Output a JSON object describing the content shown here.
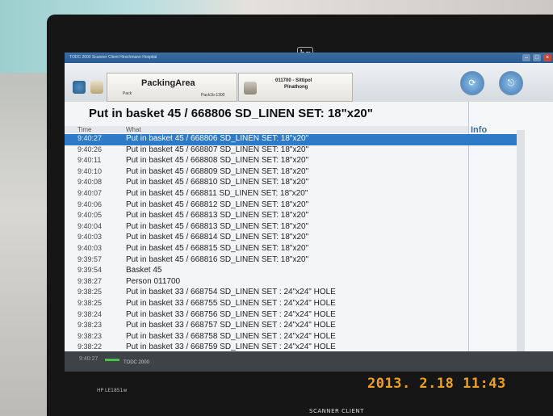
{
  "window": {
    "title": "TODC 2000 Scanner Client Hirschmann Hospital"
  },
  "toolbar": {
    "area_title": "PackingArea",
    "pack_label": "Pack",
    "station": "Pack1b-1300",
    "user_id_line": "011700 - Sittipol",
    "user_name_line": "Pinathong"
  },
  "headline": "Put in basket 45 / 668806 SD_LINEN SET: 18\"x20\"",
  "info_label": "Info",
  "columns": {
    "time": "Time",
    "what": "What"
  },
  "rows": [
    {
      "time": "9:40:27",
      "what": "Put in basket 45 / 668806 SD_LINEN SET: 18\"x20\"",
      "selected": true
    },
    {
      "time": "9:40:26",
      "what": "Put in basket 45 / 668807 SD_LINEN SET: 18\"x20\""
    },
    {
      "time": "9:40:11",
      "what": "Put in basket 45 / 668808 SD_LINEN SET: 18\"x20\""
    },
    {
      "time": "9:40:10",
      "what": "Put in basket 45 / 668809 SD_LINEN SET: 18\"x20\""
    },
    {
      "time": "9:40:08",
      "what": "Put in basket 45 / 668810 SD_LINEN SET: 18\"x20\""
    },
    {
      "time": "9:40:07",
      "what": "Put in basket 45 / 668811 SD_LINEN SET: 18\"x20\""
    },
    {
      "time": "9:40:06",
      "what": "Put in basket 45 / 668812 SD_LINEN SET: 18\"x20\""
    },
    {
      "time": "9:40:05",
      "what": "Put in basket 45 / 668813 SD_LINEN SET: 18\"x20\""
    },
    {
      "time": "9:40:04",
      "what": "Put in basket 45 / 668813 SD_LINEN SET: 18\"x20\""
    },
    {
      "time": "9:40:03",
      "what": "Put in basket 45 / 668814 SD_LINEN SET: 18\"x20\""
    },
    {
      "time": "9:40:03",
      "what": "Put in basket 45 / 668815 SD_LINEN SET: 18\"x20\""
    },
    {
      "time": "9:39:57",
      "what": "Put in basket 45 / 668816 SD_LINEN SET: 18\"x20\""
    },
    {
      "time": "9:39:54",
      "what": "Basket 45"
    },
    {
      "time": "9:38:27",
      "what": "Person 011700"
    },
    {
      "time": "9:38:25",
      "what": "Put in basket 33 / 668754 SD_LINEN SET : 24\"x24\" HOLE"
    },
    {
      "time": "9:38:25",
      "what": "Put in basket 33 / 668755 SD_LINEN SET : 24\"x24\" HOLE"
    },
    {
      "time": "9:38:24",
      "what": "Put in basket 33 / 668756 SD_LINEN SET : 24\"x24\" HOLE"
    },
    {
      "time": "9:38:23",
      "what": "Put in basket 33 / 668757 SD_LINEN SET : 24\"x24\" HOLE"
    },
    {
      "time": "9:38:23",
      "what": "Put in basket 33 / 668758 SD_LINEN SET : 24\"x24\" HOLE"
    },
    {
      "time": "9:38:22",
      "what": "Put in basket 33 / 668759 SD_LINEN SET : 24\"x24\" HOLE"
    }
  ],
  "footer": {
    "time": "9:40:27",
    "app_name": "TODC 2000"
  },
  "bezel": {
    "brand": "HP LE1851w",
    "caption": "SCANNER CLIENT"
  },
  "camera_stamp": "2013. 2.18  11:43",
  "colors": {
    "selection": "#2e7ac7",
    "stamp": "#f0a020",
    "info_label": "#3a6da5"
  },
  "icons": [
    "heart-icon",
    "folder-icon",
    "book-icon",
    "user-badge-icon",
    "sync-icon",
    "exit-icon",
    "hp-logo-icon"
  ]
}
